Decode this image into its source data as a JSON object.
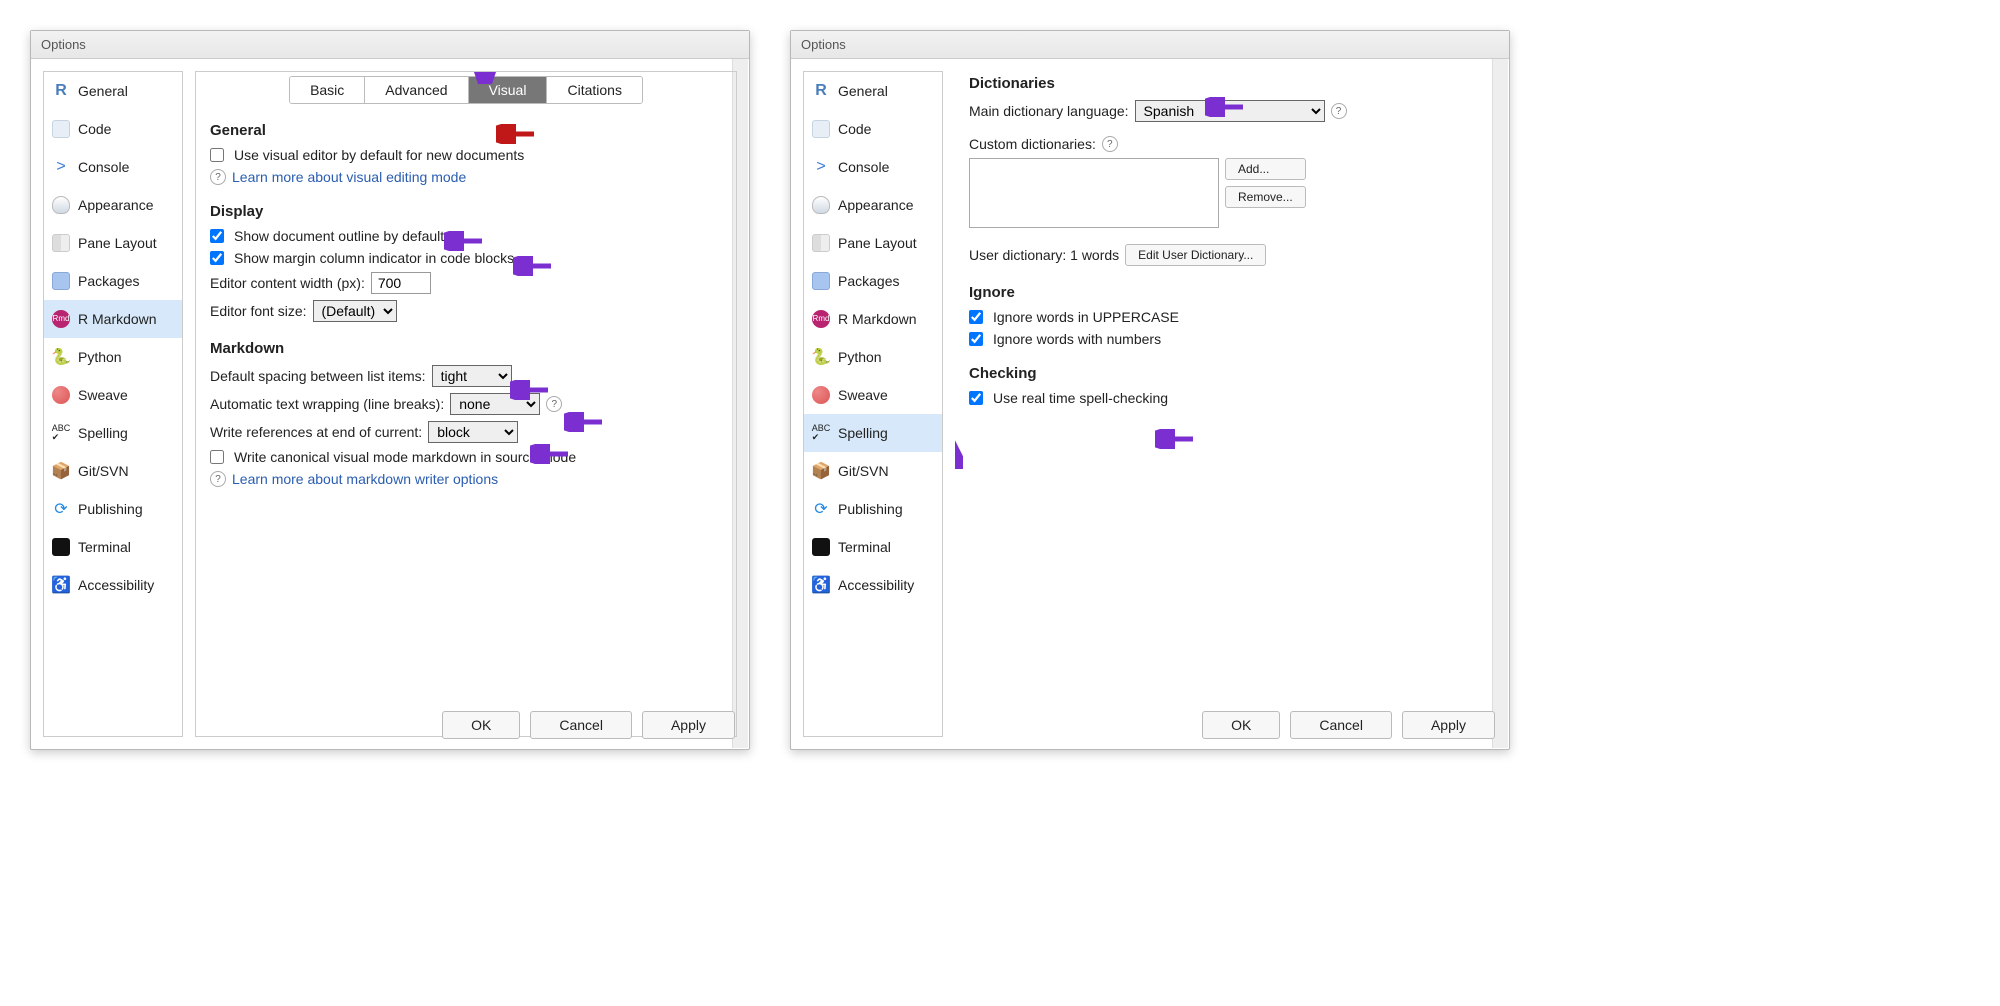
{
  "dialog_title": "Options",
  "sidebar_items": [
    {
      "label": "General"
    },
    {
      "label": "Code"
    },
    {
      "label": "Console"
    },
    {
      "label": "Appearance"
    },
    {
      "label": "Pane Layout"
    },
    {
      "label": "Packages"
    },
    {
      "label": "R Markdown"
    },
    {
      "label": "Python"
    },
    {
      "label": "Sweave"
    },
    {
      "label": "Spelling"
    },
    {
      "label": "Git/SVN"
    },
    {
      "label": "Publishing"
    },
    {
      "label": "Terminal"
    },
    {
      "label": "Accessibility"
    }
  ],
  "left": {
    "active_sidebar": "R Markdown",
    "tabs": [
      "Basic",
      "Advanced",
      "Visual",
      "Citations"
    ],
    "active_tab": "Visual",
    "sections": {
      "general": {
        "heading": "General",
        "use_visual_default": "Use visual editor by default for new documents",
        "learn_more": "Learn more about visual editing mode"
      },
      "display": {
        "heading": "Display",
        "show_outline": "Show document outline by default",
        "show_margin": "Show margin column indicator in code blocks",
        "content_width_label": "Editor content width (px):",
        "content_width_value": "700",
        "font_size_label": "Editor font size:",
        "font_size_value": "(Default)"
      },
      "markdown": {
        "heading": "Markdown",
        "spacing_label": "Default spacing between list items:",
        "spacing_value": "tight",
        "wrapping_label": "Automatic text wrapping (line breaks):",
        "wrapping_value": "none",
        "refs_label": "Write references at end of current:",
        "refs_value": "block",
        "canonical": "Write canonical visual mode markdown in source mode",
        "learn_more": "Learn more about markdown writer options"
      }
    }
  },
  "right": {
    "active_sidebar": "Spelling",
    "dictionaries": {
      "heading": "Dictionaries",
      "main_label": "Main dictionary language:",
      "main_value": "Spanish",
      "custom_label": "Custom dictionaries:",
      "add": "Add...",
      "remove": "Remove...",
      "user_dict_label": "User dictionary: 1 words",
      "edit_user": "Edit User Dictionary..."
    },
    "ignore": {
      "heading": "Ignore",
      "upper": "Ignore words in UPPERCASE",
      "numbers": "Ignore words with numbers"
    },
    "checking": {
      "heading": "Checking",
      "realtime": "Use real time spell-checking"
    }
  },
  "buttons": {
    "ok": "OK",
    "cancel": "Cancel",
    "apply": "Apply"
  }
}
